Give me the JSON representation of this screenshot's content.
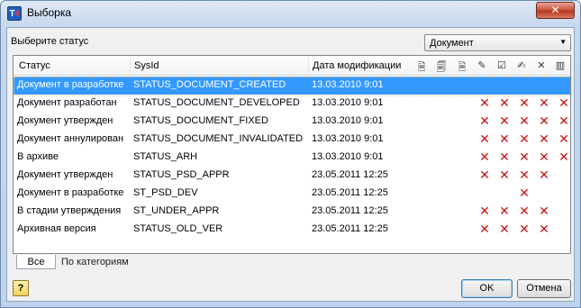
{
  "window": {
    "title": "Выборка",
    "close_glyph": "✕"
  },
  "filter": {
    "label": "Выберите статус",
    "selected": "Документ"
  },
  "table": {
    "columns": [
      "Статус",
      "SysId",
      "Дата модификации"
    ],
    "header_icons": [
      "doc-arrow-icon",
      "doc-copy-icon",
      "doc-save-icon",
      "doc-sign-icon",
      "doc-check-icon",
      "doc-edit-icon",
      "delete-icon",
      "archive-icon"
    ],
    "rows": [
      {
        "status": "Документ в разработке",
        "sysid": "STATUS_DOCUMENT_CREATED",
        "date": "13.03.2010 9:01",
        "marks": [
          0,
          0,
          0,
          0,
          0
        ]
      },
      {
        "status": "Документ разработан",
        "sysid": "STATUS_DOCUMENT_DEVELOPED",
        "date": "13.03.2010 9:01",
        "marks": [
          1,
          1,
          1,
          1,
          1
        ]
      },
      {
        "status": "Документ утвержден",
        "sysid": "STATUS_DOCUMENT_FIXED",
        "date": "13.03.2010 9:01",
        "marks": [
          1,
          1,
          1,
          1,
          1
        ]
      },
      {
        "status": "Документ аннулирован",
        "sysid": "STATUS_DOCUMENT_INVALIDATED",
        "date": "13.03.2010 9:01",
        "marks": [
          1,
          1,
          1,
          1,
          1
        ]
      },
      {
        "status": "В архиве",
        "sysid": "STATUS_ARH",
        "date": "13.03.2010 9:01",
        "marks": [
          1,
          1,
          1,
          1,
          1
        ]
      },
      {
        "status": "Документ утвержден",
        "sysid": "STATUS_PSD_APPR",
        "date": "23.05.2011 12:25",
        "marks": [
          1,
          1,
          1,
          1,
          0
        ]
      },
      {
        "status": "Документ в разработке",
        "sysid": "ST_PSD_DEV",
        "date": "23.05.2011 12:25",
        "marks": [
          0,
          0,
          1,
          0,
          0
        ]
      },
      {
        "status": "В стадии утверждения",
        "sysid": "ST_UNDER_APPR",
        "date": "23.05.2011 12:25",
        "marks": [
          1,
          1,
          1,
          1,
          0
        ]
      },
      {
        "status": "Архивная версия",
        "sysid": "STATUS_OLD_VER",
        "date": "23.05.2011 12:25",
        "marks": [
          1,
          1,
          1,
          1,
          0
        ]
      }
    ]
  },
  "tabs": [
    "Все",
    "По категориям"
  ],
  "buttons": {
    "ok": "OK",
    "cancel": "Отмена"
  },
  "colors": {
    "selection": "#3399ff",
    "mark": "#c81414"
  }
}
